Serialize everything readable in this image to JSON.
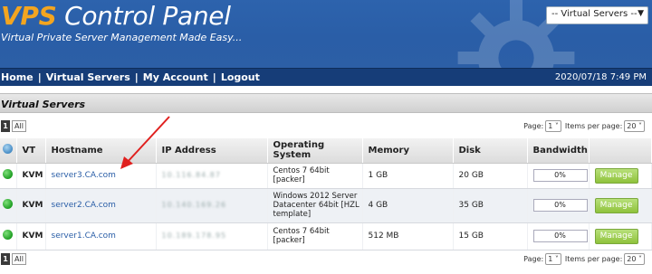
{
  "header": {
    "logo_prefix": "VPS",
    "logo_rest": " Control Panel",
    "tagline": "Virtual Private Server Management Made Easy...",
    "server_select": "-- Virtual Servers --"
  },
  "nav": {
    "items": [
      "Home",
      "Virtual Servers",
      "My Account",
      "Logout"
    ],
    "datetime": "2020/07/18 7:49 PM"
  },
  "panel": {
    "title": "Virtual Servers"
  },
  "pager": {
    "current_page": "1",
    "all_label": "All",
    "page_label": "Page:",
    "page_value": "1",
    "per_page_label": "Items per page:",
    "per_page_value": "20"
  },
  "table": {
    "columns": [
      "",
      "VT",
      "Hostname",
      "IP Address",
      "Operating System",
      "Memory",
      "Disk",
      "Bandwidth",
      ""
    ],
    "rows": [
      {
        "vt": "KVM",
        "hostname": "server3.CA.com",
        "ip": "10.116.84.87",
        "os": "Centos 7 64bit [packer]",
        "memory": "1 GB",
        "disk": "20 GB",
        "bandwidth": "0%",
        "action": "Manage"
      },
      {
        "vt": "KVM",
        "hostname": "server2.CA.com",
        "ip": "10.140.169.26",
        "os": "Windows 2012 Server Datacenter 64bit [HZL template]",
        "memory": "4 GB",
        "disk": "35 GB",
        "bandwidth": "0%",
        "action": "Manage"
      },
      {
        "vt": "KVM",
        "hostname": "server1.CA.com",
        "ip": "10.189.178.95",
        "os": "Centos 7 64bit [packer]",
        "memory": "512 MB",
        "disk": "15 GB",
        "bandwidth": "0%",
        "action": "Manage"
      }
    ]
  },
  "colors": {
    "header_blue": "#2d63ad",
    "nav_blue": "#163d78",
    "logo_orange": "#f3a520",
    "manage_green": "#8fc23c",
    "status_green": "#1e9e23",
    "annotation_red": "#e0201e"
  }
}
